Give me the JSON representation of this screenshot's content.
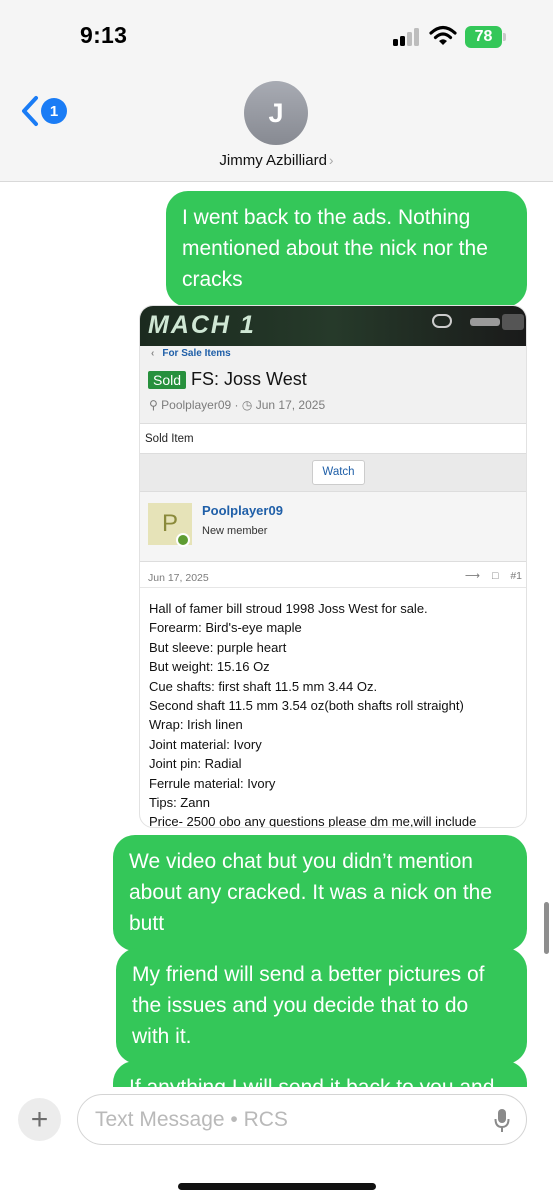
{
  "status_bar": {
    "time": "9:13",
    "battery": "78",
    "battery_color": "#34c759"
  },
  "header": {
    "back_badge": "1",
    "avatar_initial": "J",
    "contact_name": "Jimmy Azbilliard",
    "chevron": "›"
  },
  "messages": [
    {
      "text": "I went back to the ads. Nothing mentioned about the nick nor the cracks"
    },
    {
      "text": "We video chat but you didn’t mention about any cracked. It was a nick on the butt"
    },
    {
      "text": "My friend will send a better pictures of the issues and you decide that to do with it."
    },
    {
      "text": "If anything I will send it back to you and"
    }
  ],
  "bubble_color": "#34c759",
  "attachment": {
    "banner_title": "MACH 1",
    "breadcrumb": "For Sale Items",
    "sold_badge": "Sold",
    "thread_title": "FS: Joss West",
    "author": "Poolplayer09",
    "date": "Jun 17, 2025",
    "sold_item_label": "Sold Item",
    "watch_label": "Watch",
    "user_initial": "P",
    "user_name": "Poolplayer09",
    "user_role": "New member",
    "post_date": "Jun 17, 2025",
    "post_number": "#1",
    "post_lines": [
      "Hall of famer bill stroud 1998 Joss West for sale.",
      "Forearm: Bird's-eye maple",
      "But sleeve: purple heart",
      "But weight: 15.16 Oz",
      "Cue shafts: first shaft 11.5 mm 3.44 Oz.",
      "Second shaft 11.5 mm 3.54 oz(both shafts roll straight)",
      "Wrap: Irish linen",
      "Joint material: Ivory",
      "Joint pin: Radial",
      "Ferrule material: Ivory",
      "Tips: Zann",
      "Price- 2500 obo any questions please dm me,will include"
    ]
  },
  "composer": {
    "plus": "+",
    "placeholder": "Text Message • RCS"
  }
}
